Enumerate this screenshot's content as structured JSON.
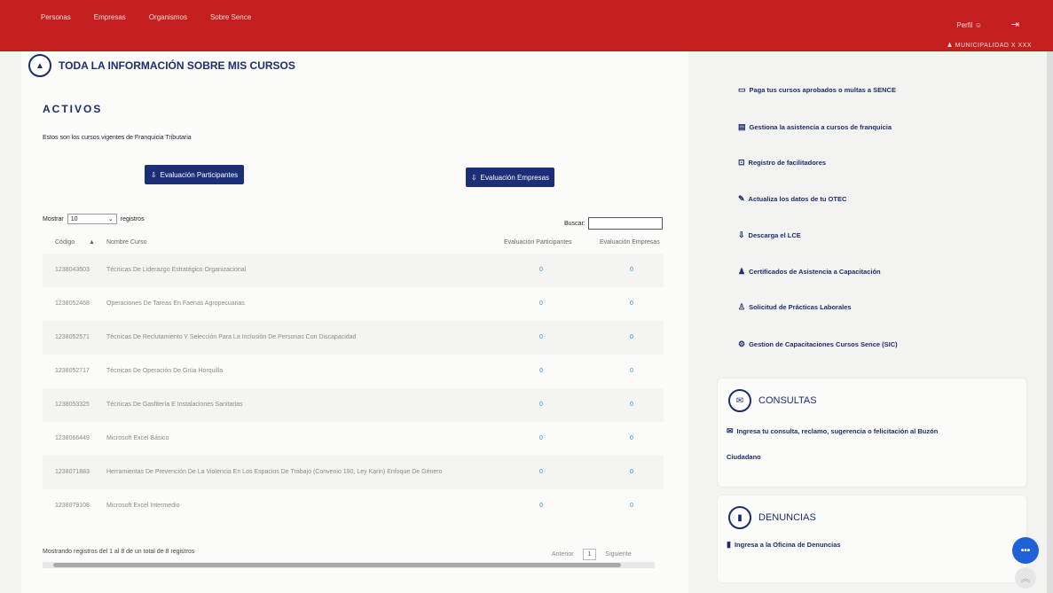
{
  "topbar": {
    "nav": [
      "Personas",
      "Empresas",
      "Organismos",
      "Sobre Sence"
    ],
    "perfil": "Perfil",
    "user": "MUNICIPALIDAD X XXX"
  },
  "main": {
    "section_title": "TODA LA INFORMACIÓN SOBRE MIS CURSOS",
    "activos_heading": "ACTIVOS",
    "activos_desc": "Estos son los cursos vigentes de Franquicia Tributaria",
    "btn_participantes": "Evaluación Participantes",
    "btn_empresas": "Evaluación Empresas",
    "mostrar": "Mostrar",
    "mostrar_value": "10",
    "registros": "registros",
    "buscar": "Buscar:",
    "columns": [
      "Código",
      "Nombre Curso",
      "Evaluación Participantes",
      "Evaluación Empresas"
    ],
    "rows": [
      {
        "codigo": "1238043603",
        "nombre": "Técnicas De Liderazgo Estratégico Organizacional",
        "ep": "0",
        "ee": "0"
      },
      {
        "codigo": "1238052468",
        "nombre": "Operaciones De Tareas En Faenas Agropecuarias",
        "ep": "0",
        "ee": "0"
      },
      {
        "codigo": "1238052571",
        "nombre": "Técnicas De Reclutamiento Y Selección Para La Inclusión De Personas Con Discapacidad",
        "ep": "0",
        "ee": "0"
      },
      {
        "codigo": "1238052717",
        "nombre": "Técnicas De Operación De Grúa Horquilla",
        "ep": "0",
        "ee": "0"
      },
      {
        "codigo": "1238053325",
        "nombre": "Técnicas De Gasfitería E Instalaciones Sanitarias",
        "ep": "0",
        "ee": "0"
      },
      {
        "codigo": "1238066449",
        "nombre": "Microsoft Excel Básico",
        "ep": "0",
        "ee": "0"
      },
      {
        "codigo": "1238071883",
        "nombre": "Herramientas De Prevención De La Violencia En Los Espacios De Trabajo (Convenio 190, Ley Karin) Enfoque De Género",
        "ep": "0",
        "ee": "0"
      },
      {
        "codigo": "1238079108",
        "nombre": "Microsoft Excel Intermedio",
        "ep": "0",
        "ee": "0"
      }
    ],
    "table_info": "Mostrando registros del 1 al 8 de un total de 8 registros",
    "anterior": "Anterior",
    "page": "1",
    "siguiente": "Siguiente"
  },
  "side": {
    "links": [
      {
        "icon": "payment-icon",
        "glyph": "▭",
        "label": "Paga tus cursos aprobados o multas a SENCE"
      },
      {
        "icon": "attendance-icon",
        "glyph": "▤",
        "label": "Gestiona la asistencia a cursos de franquicia"
      },
      {
        "icon": "facilitators-icon",
        "glyph": "⊡",
        "label": "Registro de facilitadores"
      },
      {
        "icon": "edit-icon",
        "glyph": "✎",
        "label": "Actualiza los datos de tu OTEC"
      },
      {
        "icon": "download-icon",
        "glyph": "⇩",
        "label": "Descarga el LCE"
      },
      {
        "icon": "certificates-icon",
        "glyph": "♟",
        "label": "Certificados de Asistencia a Capacitación"
      },
      {
        "icon": "internship-icon",
        "glyph": "♙",
        "label": "Solicitud de Prácticas Laborales"
      },
      {
        "icon": "management-icon",
        "glyph": "⚙",
        "label": "Gestion de Capacitaciones Cursos Sence (SIC)"
      }
    ],
    "consultas": {
      "title": "CONSULTAS",
      "link_line1": "Ingresa tu consulta, reclamo, sugerencia o felicitación al Buzón",
      "link_line2": "Ciudadano"
    },
    "denuncias": {
      "title": "DENUNCIAS",
      "link": "Ingresa a la Oficina de Denuncias"
    }
  },
  "colors": {
    "topbar": "#c41f1f",
    "primary": "#1c2e78",
    "chat": "#2060d8"
  }
}
